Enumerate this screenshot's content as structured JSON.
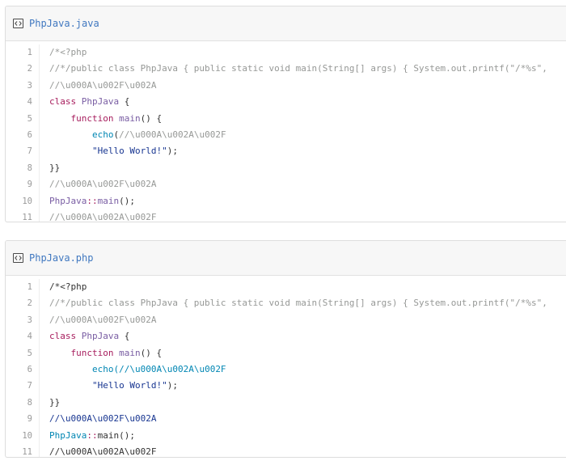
{
  "files": [
    {
      "filename": "PhpJava.java",
      "lines": [
        {
          "num": "1",
          "tokens": [
            {
              "t": "/*<?php",
              "c": "c"
            }
          ]
        },
        {
          "num": "2",
          "tokens": [
            {
              "t": "//*/public class PhpJava { public static void main(String[] args) { System.out.printf(\"/*%s\", ",
              "c": "c"
            }
          ]
        },
        {
          "num": "3",
          "tokens": [
            {
              "t": "//\\u000A\\u002F\\u002A",
              "c": "c"
            }
          ]
        },
        {
          "num": "4",
          "tokens": [
            {
              "t": "class ",
              "c": "k"
            },
            {
              "t": "PhpJava",
              "c": "e"
            },
            {
              "t": " {",
              "c": "p"
            }
          ]
        },
        {
          "num": "5",
          "tokens": [
            {
              "t": "    function ",
              "c": "k"
            },
            {
              "t": "main",
              "c": "e"
            },
            {
              "t": "() {",
              "c": "p"
            }
          ]
        },
        {
          "num": "6",
          "tokens": [
            {
              "t": "        echo",
              "c": "n"
            },
            {
              "t": "(",
              "c": "p"
            },
            {
              "t": "//\\u000A\\u002A\\u002F",
              "c": "c"
            }
          ]
        },
        {
          "num": "7",
          "tokens": [
            {
              "t": "        \"Hello World!\"",
              "c": "s"
            },
            {
              "t": ");",
              "c": "p"
            }
          ]
        },
        {
          "num": "8",
          "tokens": [
            {
              "t": "}}",
              "c": "p"
            }
          ]
        },
        {
          "num": "9",
          "tokens": [
            {
              "t": "//\\u000A\\u002F\\u002A",
              "c": "c"
            }
          ]
        },
        {
          "num": "10",
          "tokens": [
            {
              "t": "PhpJava",
              "c": "e"
            },
            {
              "t": "::",
              "c": "k"
            },
            {
              "t": "main",
              "c": "e"
            },
            {
              "t": "();",
              "c": "p"
            }
          ]
        },
        {
          "num": "11",
          "tokens": [
            {
              "t": "//\\u000A\\u002A\\u002F",
              "c": "c"
            }
          ]
        }
      ]
    },
    {
      "filename": "PhpJava.php",
      "lines": [
        {
          "num": "1",
          "tokens": [
            {
              "t": "/*<?php",
              "c": "p"
            }
          ]
        },
        {
          "num": "2",
          "tokens": [
            {
              "t": "//*/public class PhpJava { public static void main(String[] args) { System.out.printf(\"/*%s\", ",
              "c": "c"
            }
          ]
        },
        {
          "num": "3",
          "tokens": [
            {
              "t": "//\\u000A\\u002F\\u002A",
              "c": "c"
            }
          ]
        },
        {
          "num": "4",
          "tokens": [
            {
              "t": "class ",
              "c": "k"
            },
            {
              "t": "PhpJava",
              "c": "e"
            },
            {
              "t": " {",
              "c": "p"
            }
          ]
        },
        {
          "num": "5",
          "tokens": [
            {
              "t": "    function ",
              "c": "k"
            },
            {
              "t": "main",
              "c": "e"
            },
            {
              "t": "() {",
              "c": "p"
            }
          ]
        },
        {
          "num": "6",
          "tokens": [
            {
              "t": "        echo",
              "c": "n"
            },
            {
              "t": "(//\\u000A\\u002A\\u002F",
              "c": "n"
            }
          ]
        },
        {
          "num": "7",
          "tokens": [
            {
              "t": "        \"Hello World!\"",
              "c": "s"
            },
            {
              "t": ");",
              "c": "p"
            }
          ]
        },
        {
          "num": "8",
          "tokens": [
            {
              "t": "}}",
              "c": "p"
            }
          ]
        },
        {
          "num": "9",
          "tokens": [
            {
              "t": "//\\u000A\\u002F\\u002A",
              "c": "s"
            }
          ]
        },
        {
          "num": "10",
          "tokens": [
            {
              "t": "PhpJava",
              "c": "n"
            },
            {
              "t": "::",
              "c": "k"
            },
            {
              "t": "main",
              "c": "p"
            },
            {
              "t": "();",
              "c": "p"
            }
          ]
        },
        {
          "num": "11",
          "tokens": [
            {
              "t": "//\\u000A\\u002A\\u002F",
              "c": "p"
            }
          ]
        }
      ]
    }
  ],
  "icons": {
    "file_icon": "code-file-icon"
  },
  "colors": {
    "link": "#4078c0",
    "comment": "#969896",
    "keyword": "#a71d5d",
    "entity": "#795da3",
    "constant": "#0086b3",
    "string": "#183691"
  }
}
